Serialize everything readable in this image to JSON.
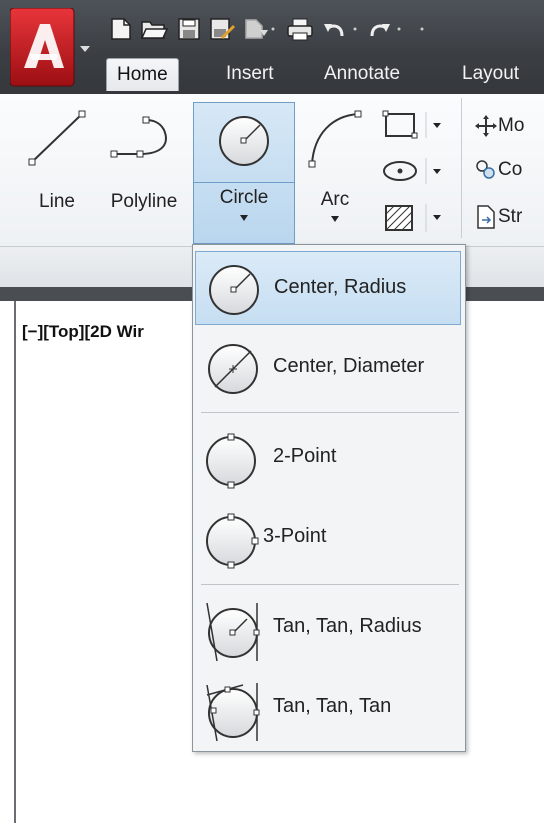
{
  "ribbon_tabs": [
    {
      "label": "Home",
      "active": true
    },
    {
      "label": "Insert",
      "active": false
    },
    {
      "label": "Annotate",
      "active": false
    },
    {
      "label": "Layout",
      "active": false
    }
  ],
  "draw_tools": {
    "line": "Line",
    "polyline": "Polyline",
    "circle": "Circle",
    "arc": "Arc"
  },
  "modify_tools": {
    "move": "Mo",
    "copy": "Co",
    "stretch": "Str"
  },
  "viewport_label": "[−][Top][2D Wir",
  "circle_menu": {
    "items": [
      {
        "label": "Center, Radius",
        "icon": "center-radius-icon",
        "highlighted": true
      },
      {
        "label": "Center, Diameter",
        "icon": "center-diameter-icon",
        "highlighted": false
      },
      {
        "label": "2-Point",
        "icon": "two-point-icon",
        "highlighted": false
      },
      {
        "label": "3-Point",
        "icon": "three-point-icon",
        "highlighted": false
      },
      {
        "label": "Tan, Tan, Radius",
        "icon": "tan-tan-radius-icon",
        "highlighted": false
      },
      {
        "label": "Tan, Tan, Tan",
        "icon": "tan-tan-tan-icon",
        "highlighted": false
      }
    ]
  },
  "colors": {
    "accent_highlight": "#c6def2",
    "app_red": "#c8171c",
    "title_bar": "#3f4348"
  }
}
